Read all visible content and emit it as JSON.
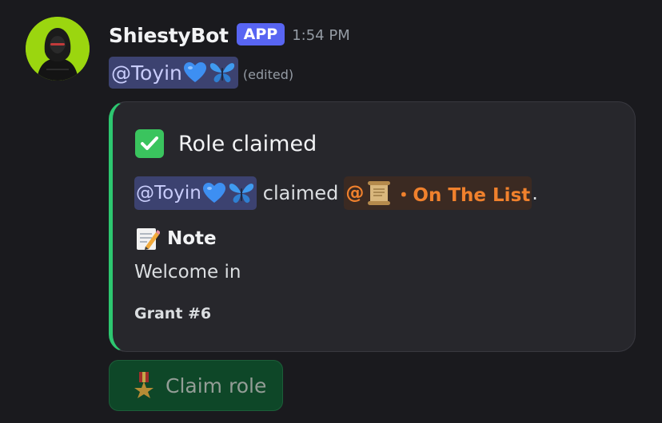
{
  "message": {
    "author": "ShiestyBot",
    "badge": "APP",
    "timestamp": "1:54 PM",
    "mention": "@Toyin",
    "edited": "(edited)"
  },
  "embed": {
    "accent_color": "#2dc770",
    "title": "Role claimed",
    "claimant_mention": "@Toyin",
    "claimed_word": "claimed",
    "role_at": "@",
    "role_name": "・On The List",
    "period": ".",
    "field_name": "Note",
    "field_value": "Welcome in",
    "footer": "Grant #6"
  },
  "button": {
    "label": "Claim role",
    "color": "#0d4f2a"
  },
  "icons": {
    "check": "white-check-mark-icon",
    "heart": "blue-heart-icon",
    "butterfly": "butterfly-icon",
    "scroll": "scroll-icon",
    "memo": "memo-icon",
    "medal": "military-medal-icon"
  }
}
